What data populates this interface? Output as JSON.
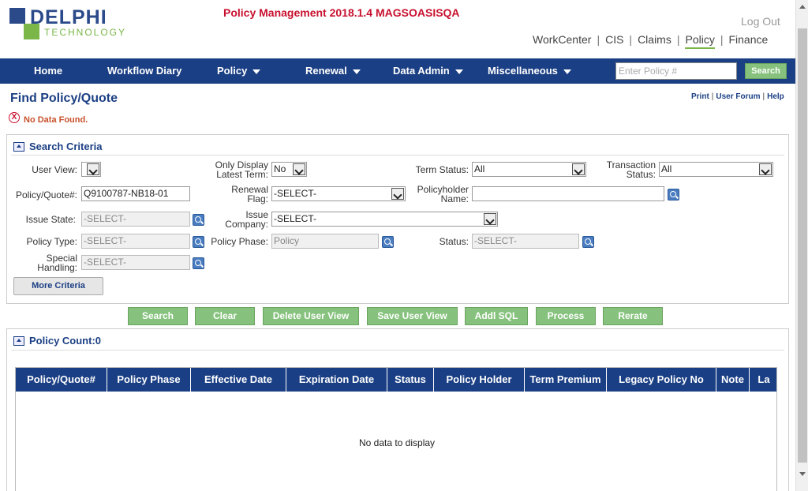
{
  "brand": {
    "logo_main": "DELPHI",
    "logo_sub": "TECHNOLOGY",
    "primary_color": "#1b3f84",
    "accent_color": "#7ab648"
  },
  "app_title": "Policy Management 2018.1.4 MAGSOASISQA",
  "logout_label": "Log Out",
  "top_nav": [
    "WorkCenter",
    "CIS",
    "Claims",
    "Policy",
    "Finance"
  ],
  "top_nav_active": "Policy",
  "menu": {
    "items": [
      "Home",
      "Workflow Diary",
      "Policy",
      "Renewal",
      "Data Admin",
      "Miscellaneous"
    ],
    "policy_placeholder": "Enter Policy #",
    "search_label": "Search"
  },
  "page": {
    "title": "Find Policy/Quote",
    "links": [
      "Print",
      "User Forum",
      "Help"
    ],
    "error": "No Data Found."
  },
  "criteria": {
    "title": "Search Criteria",
    "labels": {
      "user_view": "User View:",
      "only_display_1": "Only Display",
      "only_display_2": "Latest Term:",
      "term_status": "Term Status:",
      "transaction_1": "Transaction",
      "transaction_2": "Status:",
      "policy_quote": "Policy/Quote#:",
      "renewal_1": "Renewal",
      "renewal_2": "Flag:",
      "holder_1": "Policyholder",
      "holder_2": "Name:",
      "issue_state": "Issue State:",
      "issue_company_1": "Issue",
      "issue_company_2": "Company:",
      "policy_type": "Policy Type:",
      "policy_phase": "Policy Phase:",
      "status": "Status:",
      "special_1": "Special",
      "special_2": "Handling:"
    },
    "values": {
      "user_view": "",
      "only_display": "No",
      "term_status": "All",
      "transaction_status": "All",
      "policy_quote": "Q9100787-NB18-01",
      "renewal_flag": "-SELECT-",
      "holder_name": "",
      "issue_state": "-SELECT-",
      "issue_company": "-SELECT-",
      "policy_type": "-SELECT-",
      "policy_phase": "Policy",
      "status": "-SELECT-",
      "special_handling": "-SELECT-"
    },
    "more_label": "More Criteria"
  },
  "actions": [
    "Search",
    "Clear",
    "Delete User View",
    "Save User View",
    "Addl SQL",
    "Process",
    "Rerate"
  ],
  "results": {
    "title": "Policy Count:0",
    "columns": [
      "Policy/Quote#",
      "Policy Phase",
      "Effective Date",
      "Expiration Date",
      "Status",
      "Policy Holder",
      "Term Premium",
      "Legacy Policy No",
      "Note",
      "La"
    ],
    "empty_text": "No data to display"
  }
}
